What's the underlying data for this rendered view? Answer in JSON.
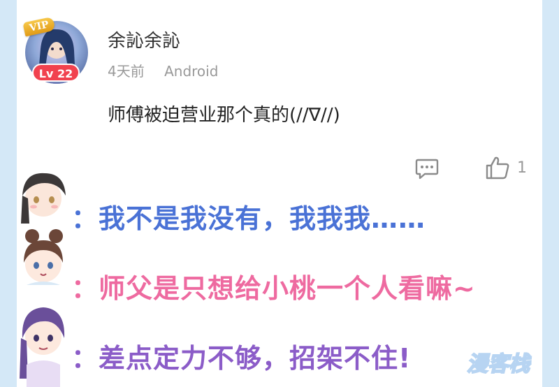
{
  "comment": {
    "vip_label": "VIP",
    "level_label": "Lv 22",
    "username": "余訫余訫",
    "time": "4天前",
    "platform": "Android",
    "text": "师傅被迫营业那个真的(//∇//)",
    "like_count": "1",
    "icons": {
      "reply": "comment-bubble-icon",
      "like": "thumbs-up-icon"
    }
  },
  "dialogue": [
    {
      "text": "：我不是我没有，我我我……",
      "color": "#4a72d6"
    },
    {
      "text": "：师父是只想给小桃一个人看嘛~",
      "color": "#ee6aa0"
    },
    {
      "text": "：差点定力不够，招架不住!",
      "color": "#8b5cc8"
    }
  ],
  "watermark": "漫客栈",
  "colors": {
    "background": "#d4e8f7",
    "panel": "#ffffff",
    "level_badge": "#f1424f",
    "vip_badge": "#e9a82a",
    "meta_text": "#999999"
  }
}
